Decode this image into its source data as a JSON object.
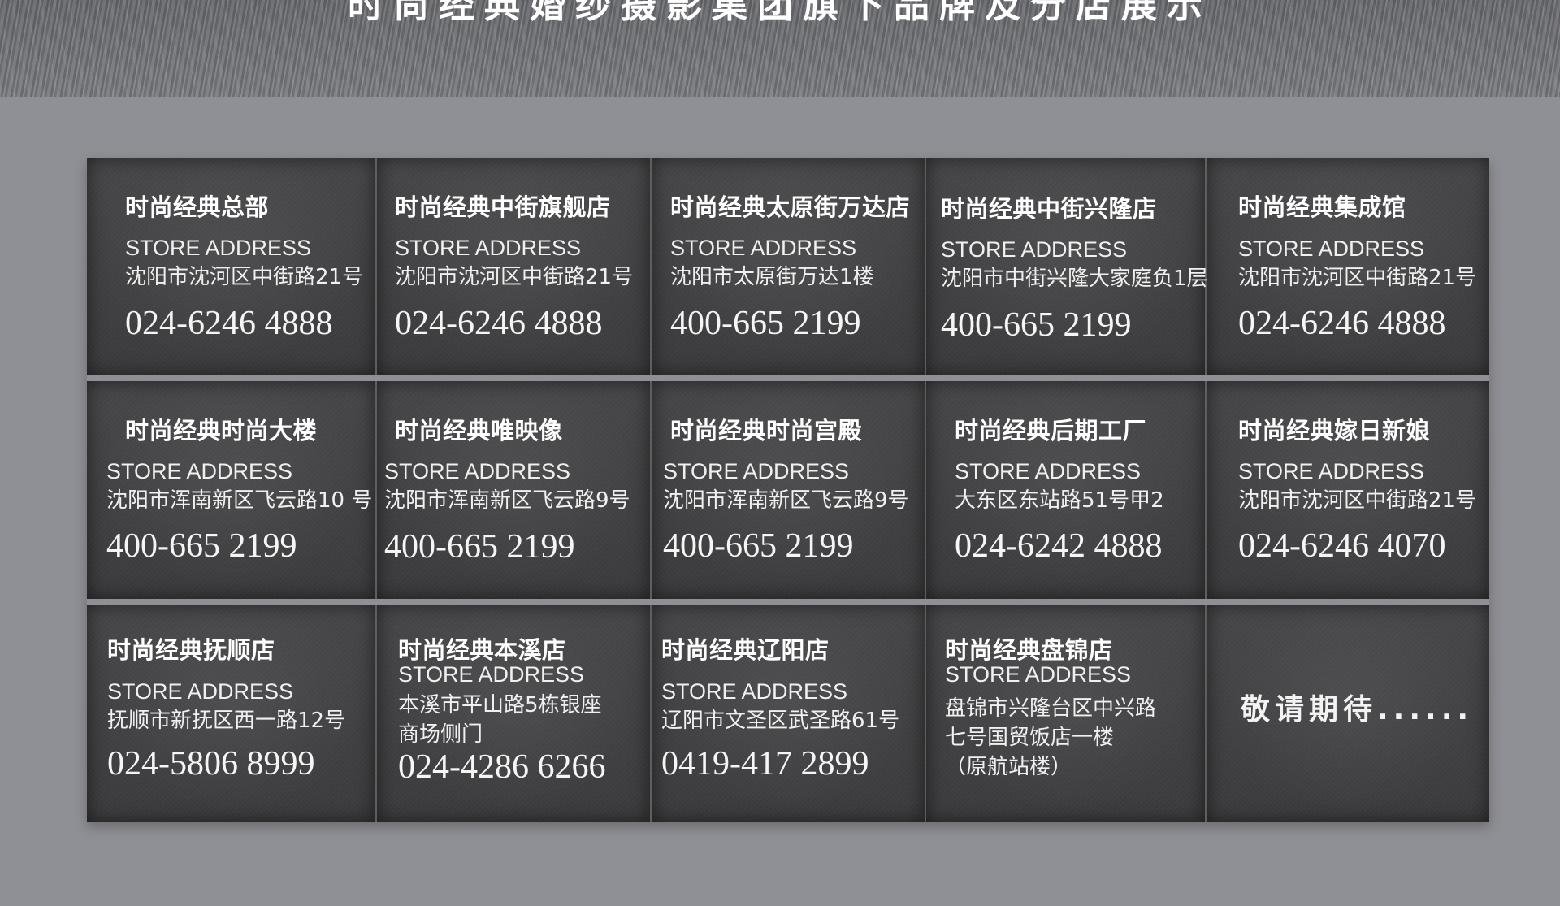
{
  "header": {
    "title": "时尚经典婚纱摄影集团旗下品牌及分店展示"
  },
  "label": "STORE ADDRESS",
  "stores": [
    {
      "name": "时尚经典总部",
      "address": "沈阳市沈河区中街路21号",
      "phone": "024-6246 4888"
    },
    {
      "name": "时尚经典中街旗舰店",
      "address": "沈阳市沈河区中街路21号",
      "phone": "024-6246 4888"
    },
    {
      "name": "时尚经典太原街万达店",
      "address": "沈阳市太原街万达1楼",
      "phone": "400-665 2199"
    },
    {
      "name": "时尚经典中街兴隆店",
      "address": "沈阳市中街兴隆大家庭负1层",
      "phone": "400-665 2199"
    },
    {
      "name": "时尚经典集成馆",
      "address": "沈阳市沈河区中街路21号",
      "phone": "024-6246 4888"
    },
    {
      "name": "时尚经典时尚大楼",
      "address": "沈阳市浑南新区飞云路10 号",
      "phone": "400-665 2199"
    },
    {
      "name": "时尚经典唯映像",
      "address": "沈阳市浑南新区飞云路9号",
      "phone": "400-665 2199"
    },
    {
      "name": "时尚经典时尚宫殿",
      "address": "沈阳市浑南新区飞云路9号",
      "phone": "400-665 2199"
    },
    {
      "name": "时尚经典后期工厂",
      "address": "大东区东站路51号甲2",
      "phone": "024-6242 4888"
    },
    {
      "name": "时尚经典嫁日新娘",
      "address": "沈阳市沈河区中街路21号",
      "phone": "024-6246 4070"
    },
    {
      "name": "时尚经典抚顺店",
      "address": "抚顺市新抚区西一路12号",
      "phone": "024-5806 8999"
    },
    {
      "name": "时尚经典本溪店",
      "address_lines": [
        "本溪市平山路5栋银座",
        "商场侧门"
      ],
      "phone": "024-4286 6266"
    },
    {
      "name": "时尚经典辽阳店",
      "address": "辽阳市文圣区武圣路61号",
      "phone": "0419-417 2899"
    },
    {
      "name": "时尚经典盘锦店",
      "address_lines": [
        "盘锦市兴隆台区中兴路",
        "七号国贸饭店一楼",
        "（原航站楼）"
      ]
    }
  ],
  "coming_soon": "敬请期待......"
}
